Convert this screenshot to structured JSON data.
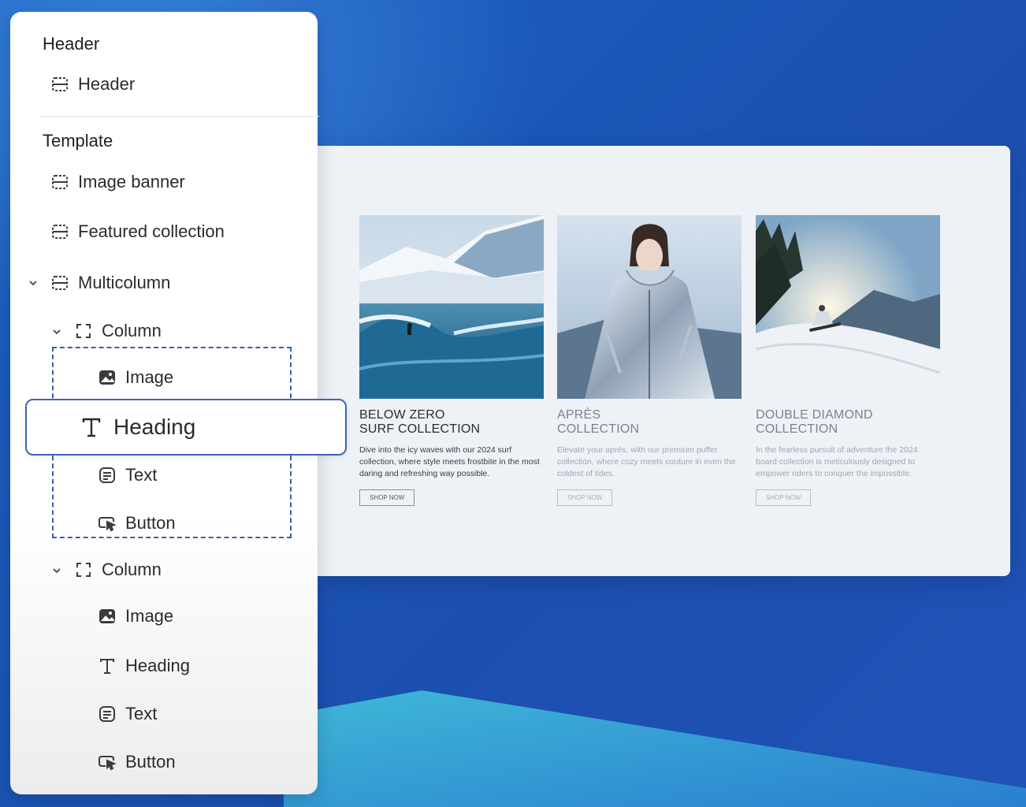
{
  "sidebar": {
    "header_section_title": "Header",
    "header_item": "Header",
    "template_section_title": "Template",
    "items": [
      {
        "label": "Image banner"
      },
      {
        "label": "Featured collection"
      },
      {
        "label": "Multicolumn"
      }
    ],
    "column1": {
      "label": "Column",
      "children": [
        "Image",
        "Heading",
        "Text",
        "Button"
      ]
    },
    "column2": {
      "label": "Column",
      "children": [
        "Image",
        "Heading",
        "Text",
        "Button"
      ]
    }
  },
  "preview": {
    "columns": [
      {
        "title": "BELOW ZERO\nSURF COLLECTION",
        "desc": "Dive into the icy waves with our 2024 surf collection, where style meets frostbite in the most daring and refreshing way possible.",
        "button": "SHOP NOW"
      },
      {
        "title": "APRÈS\nCOLLECTION",
        "desc": "Elevate your après, with our premium puffer collection, where cozy meets couture in even the coldest of tides.",
        "button": "SHOP NOW"
      },
      {
        "title": "DOUBLE DIAMOND\nCOLLECTION",
        "desc": "In the fearless pursuit of adventure the 2024 board collection is meticulously designed to empower riders to conquer the impossible.",
        "button": "SHOP NOW"
      }
    ]
  }
}
